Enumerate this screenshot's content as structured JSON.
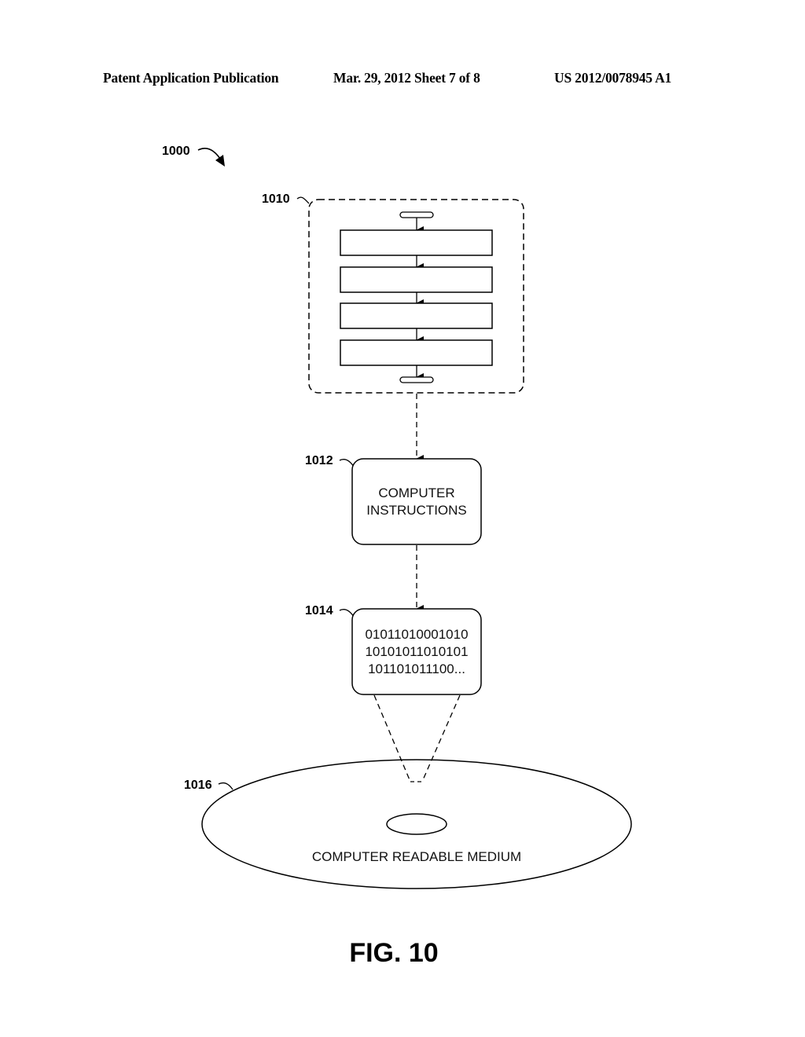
{
  "header": {
    "publication": "Patent Application Publication",
    "date_sheet": "Mar. 29, 2012  Sheet 7 of 8",
    "number": "US 2012/0078945 A1"
  },
  "figure": {
    "ref_main": "1000",
    "ref_flowchart": "1010",
    "ref_instructions": "1012",
    "ref_binary": "1014",
    "ref_medium": "1016",
    "instructions_lines": [
      "COMPUTER",
      "INSTRUCTIONS"
    ],
    "binary_lines": [
      "01011010001010",
      "10101011010101",
      "101101011100..."
    ],
    "medium_label": "COMPUTER READABLE MEDIUM",
    "flowchart_step_count": 4,
    "caption": "FIG. 10"
  }
}
